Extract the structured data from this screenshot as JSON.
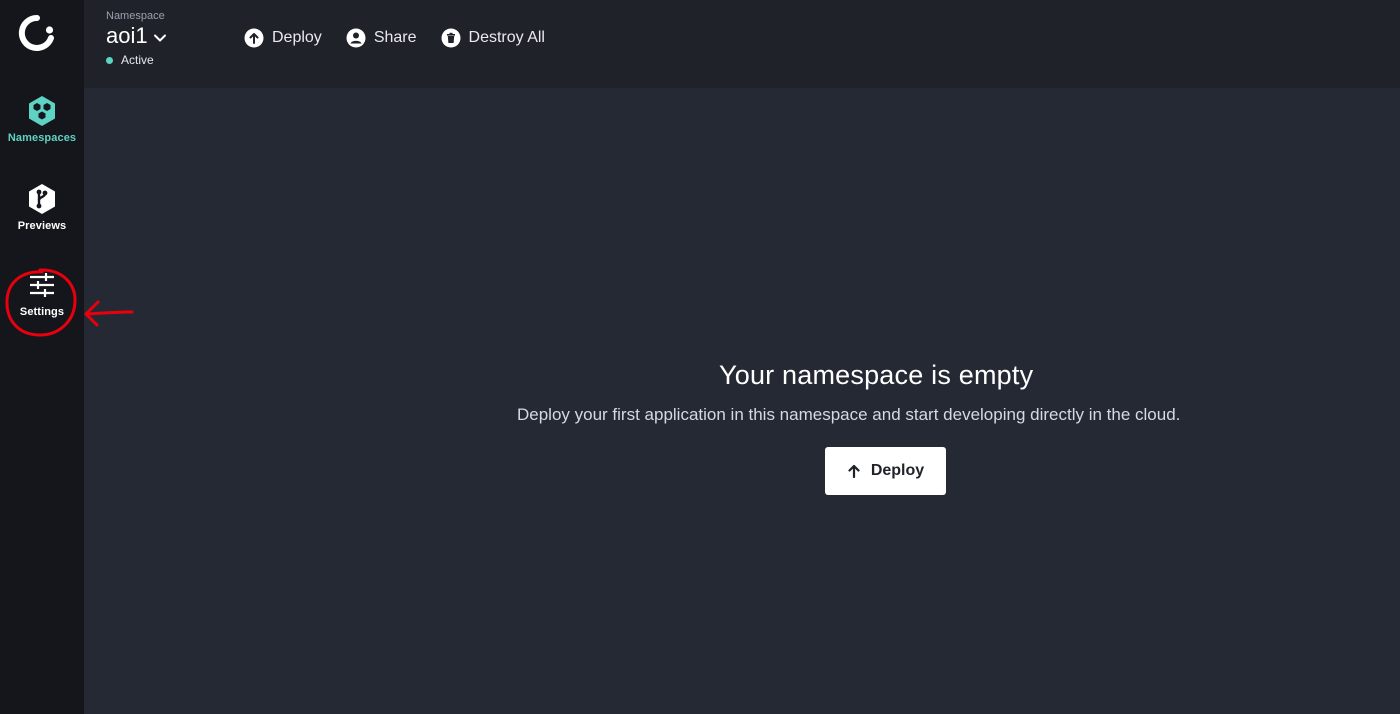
{
  "sidebar": {
    "logo": "okteto-logo",
    "items": [
      {
        "label": "Namespaces",
        "icon": "hexagon-cluster-icon",
        "active": true
      },
      {
        "label": "Previews",
        "icon": "git-branch-icon",
        "active": false
      },
      {
        "label": "Settings",
        "icon": "sliders-icon",
        "active": false
      }
    ]
  },
  "header": {
    "namespace_label": "Namespace",
    "namespace_name": "aoi1",
    "status": "Active",
    "actions": [
      {
        "label": "Deploy",
        "icon": "upload-circle-icon"
      },
      {
        "label": "Share",
        "icon": "user-circle-icon"
      },
      {
        "label": "Destroy All",
        "icon": "trash-circle-icon"
      }
    ]
  },
  "main": {
    "title": "Your namespace is empty",
    "description": "Deploy your first application in this namespace and start developing directly in the cloud.",
    "deploy_button": "Deploy"
  },
  "colors": {
    "sidebar_bg": "#14161b",
    "topbar_bg": "#1f2229",
    "content_bg": "#252933",
    "accent": "#5fd3c3",
    "annotation": "#e8000d"
  }
}
